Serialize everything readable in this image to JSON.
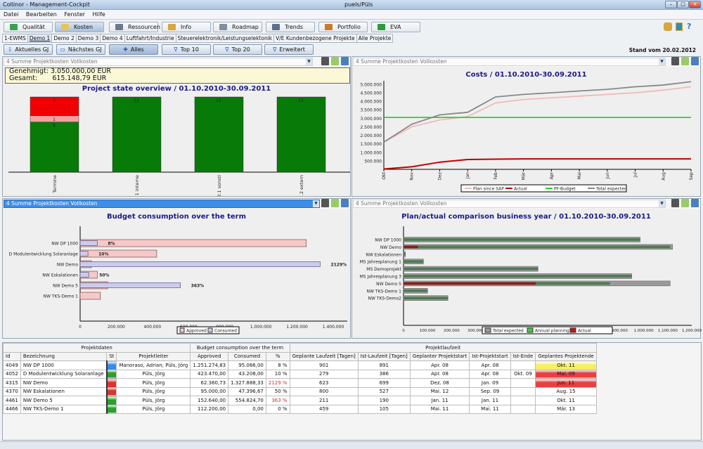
{
  "window": {
    "title": "Collinor - Management-Cockpit",
    "user": "puels/Püls"
  },
  "menu": [
    "Datei",
    "Bearbeiten",
    "Fenster",
    "Hilfe"
  ],
  "modules": [
    {
      "label": "Qualität",
      "color": "#3aa24a"
    },
    {
      "label": "Kosten",
      "color": "#e9c25a",
      "active": true
    },
    {
      "label": "Ressourcen",
      "color": "#6a7a8a"
    },
    {
      "label": "Info",
      "color": "#d8a640"
    },
    {
      "label": "Roadmap",
      "color": "#7f8fa0"
    },
    {
      "label": "Trends",
      "color": "#5b6f8a"
    },
    {
      "label": "Portfolio",
      "color": "#c87b2a"
    },
    {
      "label": "EVA",
      "color": "#2e9a3a"
    }
  ],
  "tabs": [
    "1-EWMS",
    "Demo 1",
    "Demo 2",
    "Demo 3",
    "Demo 4",
    "Luftfahrt/Industrie",
    "Steuerelektronik/Leistungselektonik",
    "V/E Kundenbezogene Projekte",
    "Alle Projekte"
  ],
  "selected_tab": "Demo 1",
  "filters": [
    {
      "label": "Aktuelles GJ",
      "icon": "⇩"
    },
    {
      "label": "Nächstes GJ",
      "icon": "▭"
    },
    {
      "label": "Alles",
      "icon": "✚",
      "selected": true
    },
    {
      "label": "Top 10",
      "icon": "∇"
    },
    {
      "label": "Top 20",
      "icon": "∇"
    },
    {
      "label": "Erweitert",
      "icon": "∇"
    }
  ],
  "stand": "Stand vom 20.02.2012",
  "panels": {
    "p1": {
      "combo": "4 Summe Projektkosten Vollkosten",
      "info": {
        "genehmigt_label": "Genehmigt:",
        "genehmigt": "3.050.000,00 EUR",
        "gesamt_label": "Gesamt:",
        "gesamt": "615.148,79 EUR"
      }
    },
    "p2": {
      "combo": "4 Summe Projektkosten Vollkosten"
    },
    "p3": {
      "combo": "4 Summe Projektkosten Vollkosten"
    },
    "p4": {
      "combo": "4 Summe Projektkosten Vollkosten"
    }
  },
  "chart_data": [
    {
      "type": "bar",
      "stacked": true,
      "title": "Project state overview / 01.10.2010-30.09.2011",
      "categories": [
        "Termine",
        "1 interne",
        "2.1 sonsti",
        "2.2 extern"
      ],
      "series": [
        {
          "color": "#087a08",
          "values": [
            8,
            12,
            12,
            12
          ]
        },
        {
          "color": "#f4a0a0",
          "values": [
            1,
            0,
            0,
            0
          ]
        },
        {
          "color": "#f00000",
          "values": [
            3,
            0,
            0,
            0
          ]
        }
      ]
    },
    {
      "type": "line",
      "title": "Costs / 01.10.2010-30.09.2011",
      "categories": [
        "Okt",
        "Nov",
        "Dez",
        "Jan",
        "Feb",
        "Mär",
        "Apr",
        "Mai",
        "Jun",
        "Jul",
        "Aug",
        "Sep"
      ],
      "yticks": [
        "500.000",
        "1.000.000",
        "1.500.000",
        "2.000.000",
        "2.500.000",
        "3.000.000",
        "3.500.000",
        "4.000.000",
        "4.500.000",
        "5.000.000"
      ],
      "ylim": [
        0,
        5200000
      ],
      "legend": "bottom",
      "series": [
        {
          "name": "Plan since SAP",
          "color": "#f2b8b8",
          "values": [
            1600000,
            2500000,
            2900000,
            3100000,
            3900000,
            4100000,
            4200000,
            4300000,
            4400000,
            4500000,
            4650000,
            4850000
          ]
        },
        {
          "name": "Actual",
          "color": "#c00000",
          "values": [
            20000,
            150000,
            420000,
            580000,
            600000,
            615000,
            615000,
            615000,
            615000,
            615000,
            615000,
            615000
          ]
        },
        {
          "name": "PF-Budget",
          "color": "#2ed02e",
          "values": [
            3050000,
            3050000,
            3050000,
            3050000,
            3050000,
            3050000,
            3050000,
            3050000,
            3050000,
            3050000,
            3050000,
            3050000
          ]
        },
        {
          "name": "Total expected",
          "color": "#888888",
          "values": [
            1600000,
            2650000,
            3200000,
            3350000,
            4250000,
            4400000,
            4500000,
            4600000,
            4700000,
            4850000,
            4950000,
            5150000
          ]
        }
      ]
    },
    {
      "type": "bar",
      "orientation": "horizontal",
      "title": "Budget consumption over the term",
      "categories": [
        "NW DP 1000",
        "D Modulentwicklung Solaranlage",
        "NW Demo",
        "NW Eskalationen",
        "NW Demo 5",
        "NW TKS-Demo 1"
      ],
      "xticks": [
        "0",
        "200.000",
        "400.000",
        "600.000",
        "800.000",
        "1.000.000",
        "1.200.000",
        "1.400.000"
      ],
      "xlim": [
        0,
        1400000
      ],
      "legend": "bottom",
      "series": [
        {
          "name": "Approved",
          "color": "#f6c8c8",
          "values": [
            1251274.83,
            423470,
            62360.73,
            95000,
            152640,
            112200
          ]
        },
        {
          "name": "Consumed",
          "color": "#cccbef",
          "values": [
            95066,
            43208,
            1327888.33,
            47396.67,
            554824.7,
            0
          ]
        }
      ],
      "labels": [
        "8%",
        "10%",
        "2129%",
        "50%",
        "363%",
        ""
      ]
    },
    {
      "type": "bar",
      "orientation": "horizontal",
      "title": "Plan/actual comparison business year / 01.10.2010-30.09.2011",
      "categories": [
        "NW DP 1000",
        "NW Demo",
        "NW Eskalationen",
        "MS Jahresplanung 1",
        "MS Demoprojekt",
        "MS Jahresplanung 3",
        "NW Demo 5",
        "NW TKS-Demo 1",
        "NW TKS-Demo2"
      ],
      "xticks": [
        "0",
        "100.000",
        "200.000",
        "300.000",
        "400.000",
        "500.000",
        "600.000",
        "700.000",
        "800.000",
        "900.000",
        "1.000.000",
        "1.100.000",
        "1.200.000"
      ],
      "xlim": [
        0,
        1200000
      ],
      "legend": "bottom",
      "series": [
        {
          "name": "Total expected",
          "color": "#9a9a9a",
          "values": [
            985000,
            1120000,
            8000,
            83000,
            560000,
            950000,
            1110000,
            100000,
            185000
          ]
        },
        {
          "name": "Annual planning",
          "color": "#4e7a52",
          "values": [
            985000,
            1110000,
            8000,
            83000,
            560000,
            950000,
            860000,
            100000,
            185000
          ]
        },
        {
          "name": "Actual",
          "color": "#8b1a1a",
          "values": [
            0,
            60000,
            0,
            0,
            0,
            0,
            550000,
            0,
            0
          ]
        }
      ]
    }
  ],
  "table": {
    "groups": [
      "Projektdaten",
      "Budget consumption over the term",
      "Projektlaufzeit"
    ],
    "headers": [
      "Id",
      "Bezeichnung",
      "St",
      "Projektleiter",
      "Approved",
      "Consumed",
      "%",
      "Geplante Laufzeit [Tagen]",
      "Ist-Laufzeit [Tagen]",
      "Geplanter Projektstart",
      "Ist-Projektstart",
      "Ist-Ende",
      "Geplantes Projektende"
    ],
    "rows": [
      {
        "cells": [
          "4049",
          "NW DP 1000",
          "",
          "Manoraso, Adrian; Püls, Jörg",
          "1.251.274,83",
          "95.066,00",
          "8 %",
          "901",
          "891",
          "Apr. 08",
          "Apr. 08",
          "",
          "Okt. 11"
        ],
        "status": "#2f8ef0",
        "end_color": "#f4f060",
        "pct_red": false
      },
      {
        "cells": [
          "4052",
          "D Modulentwicklung Solaranlage",
          "",
          "Püls, Jörg",
          "423.470,00",
          "43.208,00",
          "10 %",
          "279",
          "386",
          "Apr. 08",
          "Apr. 08",
          "Okt. 09",
          "Mai. 09"
        ],
        "status": "#2aa02a",
        "end_color": "#e84040",
        "pct_red": false
      },
      {
        "cells": [
          "4315",
          "NW Demo",
          "",
          "Püls, Jörg",
          "62.360,73",
          "1.327.888,33",
          "2129 %",
          "623",
          "699",
          "Dez. 08",
          "Jan. 09",
          "",
          "Jun. 11"
        ],
        "status": "#e03030",
        "end_color": "#e84040",
        "pct_red": true
      },
      {
        "cells": [
          "4370",
          "NW Eskalationen",
          "",
          "Püls, Jörg",
          "95.000,00",
          "47.396,67",
          "50 %",
          "800",
          "527",
          "Mai. 12",
          "Sep. 09",
          "",
          "Aug. 15"
        ],
        "status": "#e03030",
        "end_color": "",
        "pct_red": false
      },
      {
        "cells": [
          "4461",
          "NW Demo 5",
          "",
          "Püls, Jörg",
          "152.640,00",
          "554.824,70",
          "363 %",
          "211",
          "190",
          "Jan. 11",
          "Jan. 11",
          "",
          "Okt. 11"
        ],
        "status": "#2aa02a",
        "end_color": "",
        "pct_red": true
      },
      {
        "cells": [
          "4466",
          "NW TKS-Demo 1",
          "",
          "Püls, Jörg",
          "112.200,00",
          "0,00",
          "0 %",
          "459",
          "105",
          "Mai. 11",
          "Mai. 11",
          "",
          "Mär. 13"
        ],
        "status": "#2aa02a",
        "end_color": "",
        "pct_red": false
      }
    ]
  }
}
